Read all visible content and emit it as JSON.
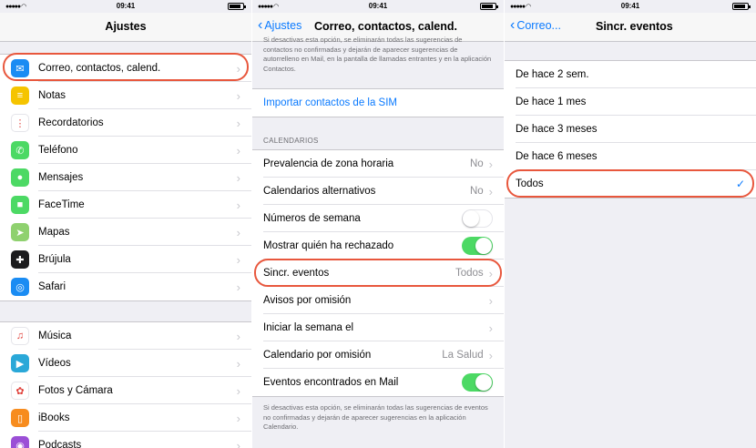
{
  "status": {
    "time": "09:41"
  },
  "panel1": {
    "title": "Ajustes",
    "groups": [
      [
        {
          "label": "Correo, contactos, calend.",
          "icon": "mail-icon",
          "color": "#1a8cf3",
          "glyph": "✉"
        },
        {
          "label": "Notas",
          "icon": "notes-icon",
          "color": "#f5c400",
          "glyph": "≡"
        },
        {
          "label": "Recordatorios",
          "icon": "reminders-icon",
          "color": "#ffffff",
          "glyph": "⋮"
        },
        {
          "label": "Teléfono",
          "icon": "phone-icon",
          "color": "#4cd964",
          "glyph": "✆"
        },
        {
          "label": "Mensajes",
          "icon": "messages-icon",
          "color": "#4cd964",
          "glyph": "●"
        },
        {
          "label": "FaceTime",
          "icon": "facetime-icon",
          "color": "#4cd964",
          "glyph": "■"
        },
        {
          "label": "Mapas",
          "icon": "maps-icon",
          "color": "#8fd16f",
          "glyph": "➤"
        },
        {
          "label": "Brújula",
          "icon": "compass-icon",
          "color": "#1c1c1e",
          "glyph": "✚"
        },
        {
          "label": "Safari",
          "icon": "safari-icon",
          "color": "#1a8cf3",
          "glyph": "◎"
        }
      ],
      [
        {
          "label": "Música",
          "icon": "music-icon",
          "color": "#ffffff",
          "glyph": "♫"
        },
        {
          "label": "Vídeos",
          "icon": "videos-icon",
          "color": "#2aa8d8",
          "glyph": "▶"
        },
        {
          "label": "Fotos y Cámara",
          "icon": "photos-icon",
          "color": "#ffffff",
          "glyph": "✿"
        },
        {
          "label": "iBooks",
          "icon": "ibooks-icon",
          "color": "#f78c1e",
          "glyph": "▯"
        },
        {
          "label": "Podcasts",
          "icon": "podcasts-icon",
          "color": "#9b4fd6",
          "glyph": "◉"
        }
      ]
    ]
  },
  "panel2": {
    "back": "Ajustes",
    "title": "Correo, contactos, calend.",
    "top_caption": "Si desactivas esta opción, se eliminarán todas las sugerencias de contactos no confirmadas y dejarán de aparecer sugerencias de autorrelleno en Mail, en la pantalla de llamadas entrantes y en la aplicación Contactos.",
    "import_sim": "Importar contactos de la SIM",
    "section_header": "CALENDARIOS",
    "rows": [
      {
        "label": "Prevalencia de zona horaria",
        "value": "No",
        "kind": "chevron"
      },
      {
        "label": "Calendarios alternativos",
        "value": "No",
        "kind": "chevron"
      },
      {
        "label": "Números de semana",
        "value": "",
        "kind": "toggle-off"
      },
      {
        "label": "Mostrar quién ha rechazado",
        "value": "",
        "kind": "toggle-on"
      },
      {
        "label": "Sincr. eventos",
        "value": "Todos",
        "kind": "chevron"
      },
      {
        "label": "Avisos por omisión",
        "value": "",
        "kind": "chevron"
      },
      {
        "label": "Iniciar la semana el",
        "value": "",
        "kind": "chevron"
      },
      {
        "label": "Calendario por omisión",
        "value": "La Salud",
        "kind": "chevron"
      },
      {
        "label": "Eventos encontrados en Mail",
        "value": "",
        "kind": "toggle-on"
      }
    ],
    "bottom_caption": "Si desactivas esta opción, se eliminarán todas las sugerencias de eventos no confirmadas y dejarán de aparecer sugerencias en la aplicación Calendario."
  },
  "panel3": {
    "back": "Correo...",
    "title": "Sincr. eventos",
    "options": [
      {
        "label": "De hace 2 sem.",
        "selected": false
      },
      {
        "label": "De hace 1 mes",
        "selected": false
      },
      {
        "label": "De hace 3 meses",
        "selected": false
      },
      {
        "label": "De hace 6 meses",
        "selected": false
      },
      {
        "label": "Todos",
        "selected": true
      }
    ]
  },
  "colors": {
    "accent": "#0a7aff",
    "highlight": "#e8573d",
    "toggle_on": "#4cd964"
  }
}
